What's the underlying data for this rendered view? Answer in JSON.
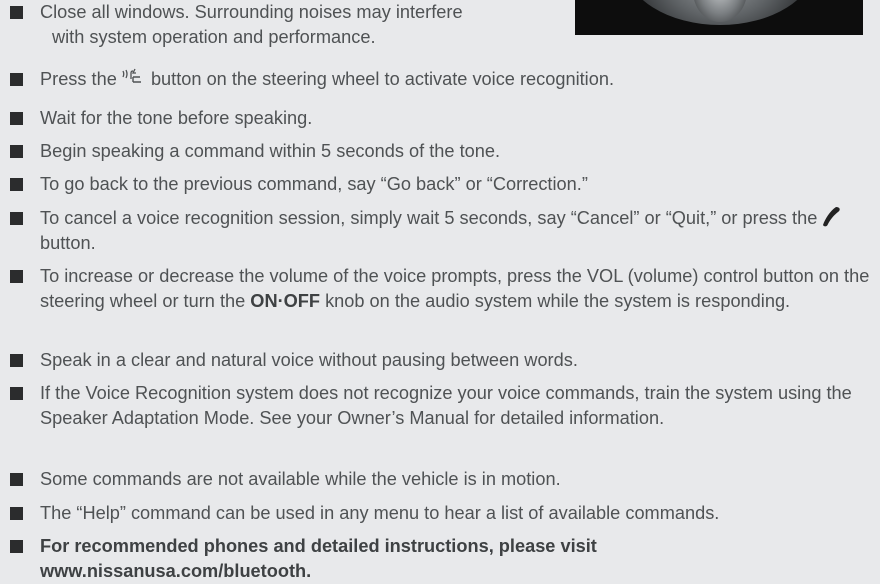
{
  "tips": [
    {
      "id": "close-windows",
      "line1": "Close all windows. Surrounding noises may interfere",
      "line2": "with system operation and performance."
    },
    {
      "id": "press-voice",
      "before": "Press the ",
      "after": " button on the steering wheel to activate voice recognition.",
      "icon": "voice-recognition-icon"
    },
    {
      "id": "wait-tone",
      "text": "Wait for the tone before speaking."
    },
    {
      "id": "begin-speaking",
      "text": "Begin speaking a command within 5 seconds of the tone."
    },
    {
      "id": "go-back",
      "text": "To go back to the previous command, say “Go back” or “Correction.”"
    },
    {
      "id": "cancel",
      "before": "To cancel a voice recognition session, simply wait 5 seconds, say “Cancel” or “Quit,” or press the ",
      "after": " button.",
      "icon": "phone-hangup-icon"
    },
    {
      "id": "volume",
      "before": "To increase or decrease the volume of the voice prompts, press the VOL (volume) control button on the steering wheel or turn the ",
      "bold": "ON·OFF",
      "after": " knob on the audio system while the system is responding."
    },
    {
      "id": "speak-clearly",
      "text": "Speak in a clear and natural voice without pausing between words."
    },
    {
      "id": "train",
      "text": "If the Voice Recognition system does not recognize your voice commands, train the system using the Speaker Adaptation Mode. See your Owner’s Manual for detailed information."
    },
    {
      "id": "motion",
      "text": "Some commands are not available while the vehicle is in motion."
    },
    {
      "id": "help",
      "text": "The “Help” command can be used in any menu to hear a list of available commands."
    },
    {
      "id": "recommended-phones",
      "text": "For recommended phones and detailed instructions, please visit www.nissanusa.com/bluetooth."
    }
  ],
  "colors": {
    "background": "#e8e9eb",
    "text": "#4f5254",
    "bullet": "#2b2c2d"
  }
}
